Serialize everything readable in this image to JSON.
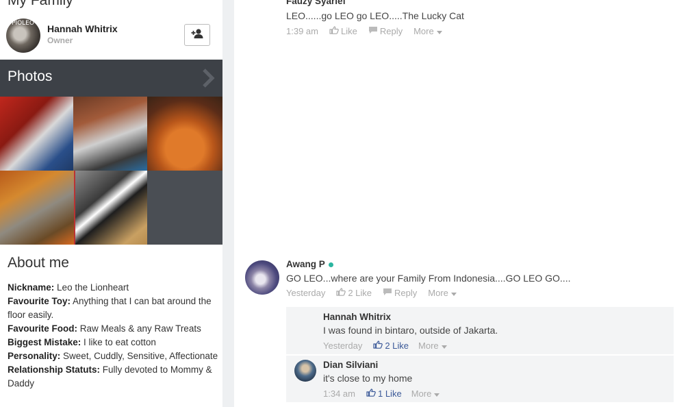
{
  "family": {
    "title": "My Family",
    "owner_name": "Hannah Whitrix",
    "owner_role": "Owner",
    "avatar_overlay": "PIOLEO"
  },
  "photos": {
    "title": "Photos",
    "count_shown": 6
  },
  "about": {
    "title": "About me",
    "fields": [
      {
        "label": "Nickname:",
        "value": "Leo the Lionheart"
      },
      {
        "label": "Favourite Toy:",
        "value": "Anything that I can bat around the floor easily."
      },
      {
        "label": "Favourite Food:",
        "value": "Raw Meals & any Raw Treats"
      },
      {
        "label": "Biggest Mistake:",
        "value": "I like to eat cotton"
      },
      {
        "label": "Personality:",
        "value": "Sweet, Cuddly, Sensitive, Affectionate"
      },
      {
        "label": "Relationship Statuts:",
        "value": "Fully devoted to Mommy & Daddy"
      }
    ]
  },
  "comments": {
    "c1": {
      "name": "Fauzy Syarief",
      "text": "LEO......go LEO go LEO.....The Lucky Cat",
      "time": "1:39 am",
      "like": "Like",
      "reply": "Reply",
      "more": "More"
    },
    "c2": {
      "name": "Awang P",
      "text": "GO LEO...where are your Family From Indonesia....GO LEO GO....",
      "time": "Yesterday",
      "like": "2 Like",
      "reply": "Reply",
      "more": "More"
    },
    "r1": {
      "name": "Hannah Whitrix",
      "text": "I was found in bintaro, outside of Jakarta.",
      "time": "Yesterday",
      "like": "2 Like",
      "more": "More"
    },
    "r2": {
      "name": "Dian Silviani",
      "text": "it's close to my home",
      "time": "1:34 am",
      "like": "1 Like",
      "more": "More"
    }
  },
  "colors": {
    "photos_bar": "#3d4147",
    "like_active": "#3b5998",
    "online": "#2bb5a0",
    "gutter": "#eef0f2"
  }
}
